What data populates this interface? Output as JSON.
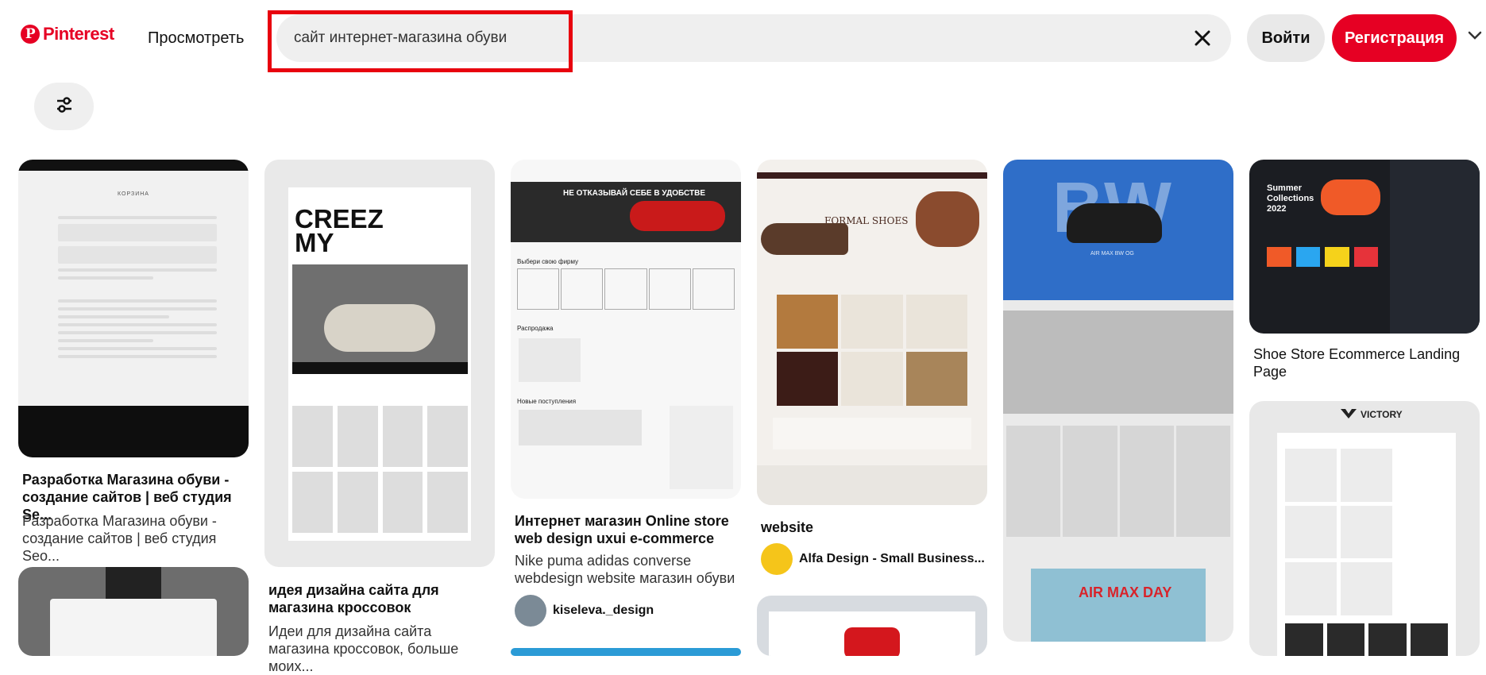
{
  "header": {
    "logo_text": "Pinterest",
    "browse_label": "Просмотреть",
    "search_value": "сайт интернет-магазина обуви",
    "login_label": "Войти",
    "register_label": "Регистрация"
  },
  "colors": {
    "brand": "#e60023",
    "highlight": "#e8020e"
  },
  "icons": [
    "pinterest-logo-icon",
    "close-icon",
    "chevron-down-icon",
    "filter-sliders-icon"
  ],
  "pins": {
    "pin1": {
      "title": "Разработка Магазина обуви - создание сайтов | веб студия Se...",
      "desc": "Разработка Магазина обуви - создание сайтов | веб студия Seo...",
      "thumb_heading": "КОРЗИНА"
    },
    "pin2": {
      "title": "идея дизайна сайта для магазина кроссовок",
      "desc": "Идеи для дизайна сайта магазина кроссовок, больше моих...",
      "thumb_heading": "CREEZ MY"
    },
    "pin3": {
      "title": "Интернет магазин Online store web design uxui e-commerce",
      "desc": "Nike puma adidas converse webdesign website магазин обуви",
      "author": "kiseleva._design",
      "thumb_banner": "НЕ ОТКАЗЫВАЙ СЕБЕ В УДОБСТВЕ",
      "thumb_brands_label": "Выбери свою фирму",
      "thumb_sale_label": "Распродажа",
      "thumb_new_label": "Новые поступления"
    },
    "pin4": {
      "title": "website",
      "author": "Alfa Design - Small Business...",
      "thumb_heading": "FORMAL SHOES"
    },
    "pin5": {
      "thumb_heading": "BW",
      "thumb_sub": "AIR MAX BW OG",
      "thumb_footer": "AIR MAX DAY"
    },
    "pin6": {
      "title": "Shoe Store Ecommerce Landing Page",
      "thumb_heading": "Summer Collections 2022",
      "thumb2_heading": "VICTORY"
    }
  }
}
